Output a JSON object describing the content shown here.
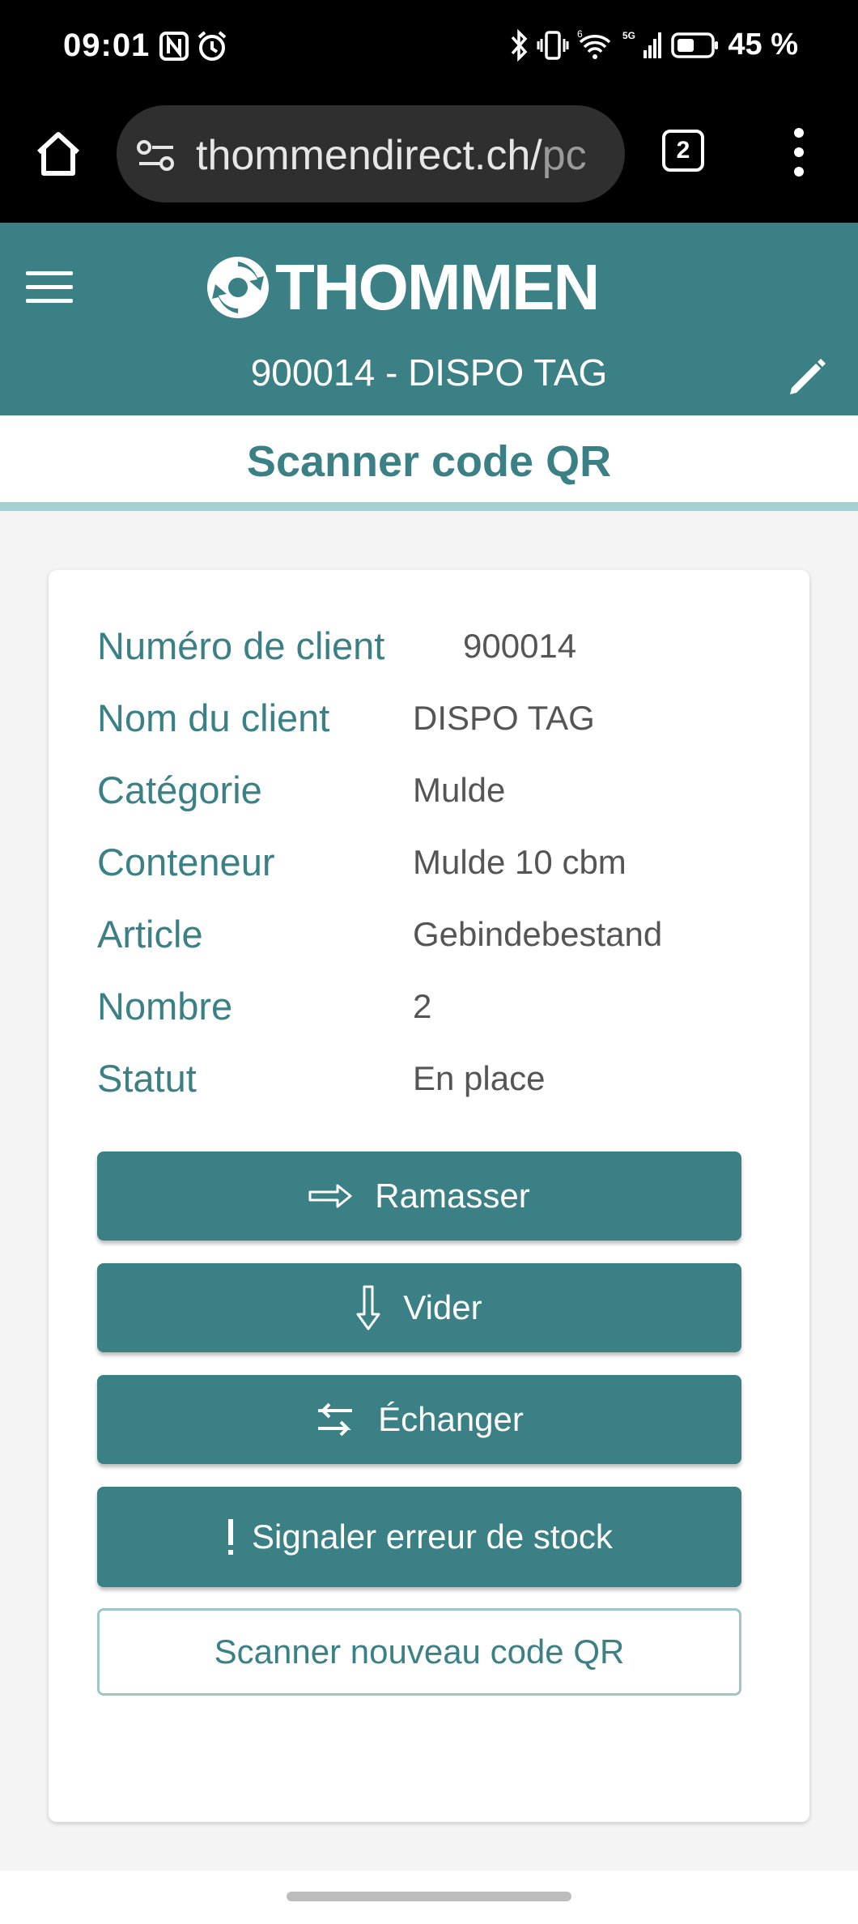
{
  "status_bar": {
    "time": "09:01",
    "battery": "45 %",
    "icons": [
      "nfc-icon",
      "alarm-icon",
      "bluetooth-icon",
      "vibrate-icon",
      "wifi-icon",
      "signal-icon",
      "battery-icon"
    ]
  },
  "browser": {
    "url_main": "thommendirect.ch/",
    "url_tail": "pc",
    "tab_count": "2"
  },
  "header": {
    "brand": "THOMMEN",
    "customer_line": "900014 - DISPO TAG"
  },
  "page": {
    "title": "Scanner code QR"
  },
  "details": [
    {
      "label": "Numéro de client",
      "value": "900014"
    },
    {
      "label": "Nom du client",
      "value": "DISPO TAG"
    },
    {
      "label": "Catégorie",
      "value": "Mulde"
    },
    {
      "label": "Conteneur",
      "value": "Mulde 10 cbm"
    },
    {
      "label": "Article",
      "value": "Gebindebestand"
    },
    {
      "label": "Nombre",
      "value": "2"
    },
    {
      "label": "Statut",
      "value": "En place"
    }
  ],
  "actions": {
    "pickup": "Ramasser",
    "empty": "Vider",
    "exchange": "Échanger",
    "report_error": "Signaler erreur de stock",
    "scan_new": "Scanner nouveau code QR"
  },
  "colors": {
    "primary": "#3a8085",
    "accent_line": "#a6cfd1"
  }
}
